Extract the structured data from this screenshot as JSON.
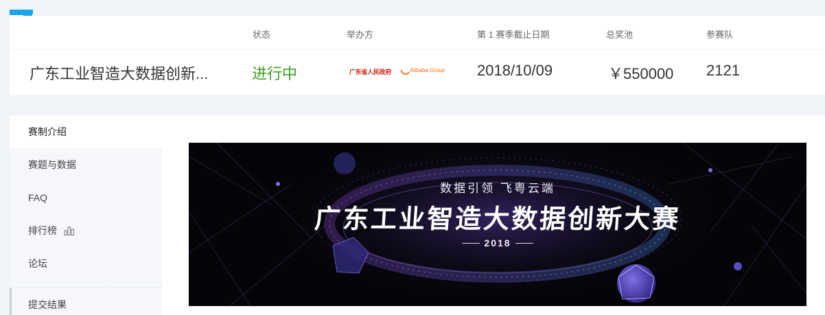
{
  "colors": {
    "accent": "#1aa7e8",
    "status_ongoing": "#3aa020",
    "page_bg": "#f0f3f7"
  },
  "competition": {
    "headers": {
      "status": "状态",
      "organizer": "举办方",
      "deadline": "第 1 赛季截止日期",
      "prize_pool": "总奖池",
      "teams": "参赛队"
    },
    "title": "广东工业智造大数据创新...",
    "status": "进行中",
    "organizers": [
      "广东省人民政府",
      "Alibaba Group"
    ],
    "deadline": "2018/10/09",
    "prize_pool": "￥550000",
    "teams": "2121"
  },
  "sidebar": {
    "items": [
      {
        "label": "赛制介绍",
        "icon": null
      },
      {
        "label": "赛题与数据",
        "icon": null
      },
      {
        "label": "FAQ",
        "icon": null
      },
      {
        "label": "排行榜",
        "icon": "bar-chart-icon"
      },
      {
        "label": "论坛",
        "icon": null
      },
      {
        "label": "提交结果",
        "icon": null
      }
    ]
  },
  "banner": {
    "subtitle": "数据引领 飞粤云端",
    "title": "广东工业智造大数据创新大赛",
    "year": "2018"
  }
}
